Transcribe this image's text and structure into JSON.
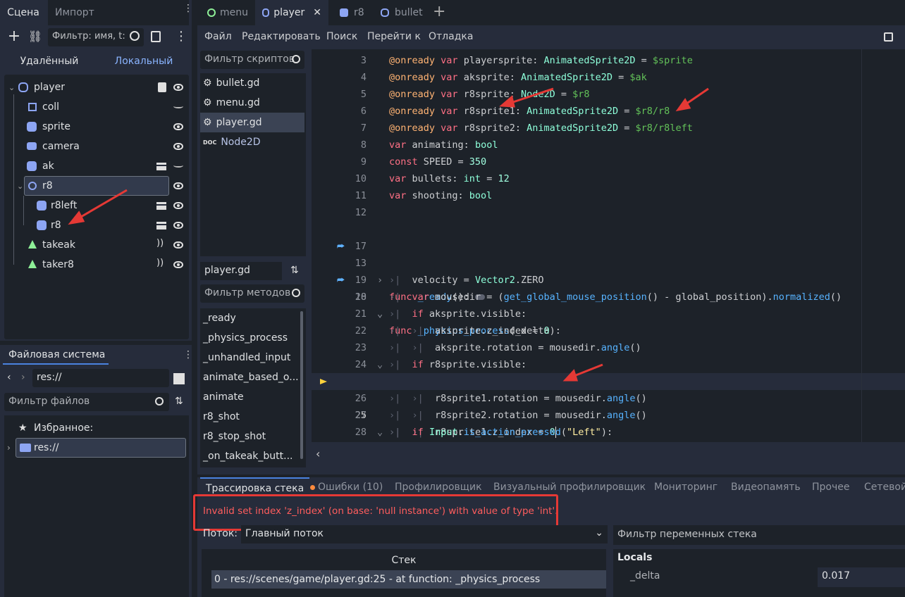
{
  "scene_dock": {
    "tabs": [
      "Сцена",
      "Импорт"
    ],
    "filter_placeholder": "Фильтр: имя, t:",
    "mode_remote": "Удалённый",
    "mode_local": "Локальный",
    "nodes": [
      {
        "label": "player",
        "icon": "character-icon"
      },
      {
        "label": "coll",
        "icon": "collision-shape-icon"
      },
      {
        "label": "sprite",
        "icon": "animated-sprite-icon"
      },
      {
        "label": "camera",
        "icon": "camera-icon"
      },
      {
        "label": "ak",
        "icon": "animated-sprite-icon"
      },
      {
        "label": "r8",
        "icon": "node2d-icon"
      },
      {
        "label": "r8left",
        "icon": "animated-sprite-icon"
      },
      {
        "label": "r8",
        "icon": "animated-sprite-icon"
      },
      {
        "label": "takeak",
        "icon": "area2d-icon"
      },
      {
        "label": "taker8",
        "icon": "area2d-icon"
      }
    ]
  },
  "filesystem_dock": {
    "title": "Файловая система",
    "path": "res://",
    "filter_placeholder": "Фильтр файлов",
    "favorites": "Избранное:",
    "root": "res://"
  },
  "editor_tabs": [
    {
      "label": "menu",
      "icon": "circle-icon"
    },
    {
      "label": "player",
      "icon": "character-icon"
    },
    {
      "label": "r8",
      "icon": "sprite-icon"
    },
    {
      "label": "bullet",
      "icon": "character-icon"
    }
  ],
  "menu": [
    "Файл",
    "Редактировать",
    "Поиск",
    "Перейти к",
    "Отладка"
  ],
  "scripts": {
    "filter_placeholder": "Фильтр скриптов",
    "items": [
      "bullet.gd",
      "menu.gd",
      "player.gd",
      "Node2D"
    ],
    "current": "player.gd",
    "methods_filter_placeholder": "Фильтр методов",
    "methods": [
      "_ready",
      "_physics_process",
      "_unhandled_input",
      "animate_based_o...",
      "animate",
      "r8_shot",
      "r8_stop_shot",
      "_on_takeak_butt..."
    ]
  },
  "code": {
    "line_numbers": [
      "3",
      "4",
      "5",
      "6",
      "7",
      "8",
      "9",
      "10",
      "11",
      "12",
      "13",
      "17",
      "18",
      "19",
      "20",
      "21",
      "22",
      "23",
      "24",
      "25",
      "26",
      "27",
      "28"
    ],
    "lines_text": [
      "@onready var playersprite: AnimatedSprite2D = $sprite",
      "@onready var aksprite: AnimatedSprite2D = $ak",
      "@onready var r8sprite: Node2D = $r8",
      "@onready var r8sprite1: AnimatedSprite2D = $r8/r8",
      "@onready var r8sprite2: AnimatedSprite2D = $r8/r8left",
      "var animating: bool",
      "const SPEED = 350",
      "var bullets: int = 12",
      "var shooting: bool",
      "",
      "func _ready():",
      "",
      "func _physics_process(_delta):",
      "velocity = Vector2.ZERO",
      "var mousedir = (get_global_mouse_position() - global_position).normalized()",
      "if aksprite.visible:",
      "aksprite.z_index = 0",
      "aksprite.rotation = mousedir.angle()",
      "if r8sprite.visible:",
      "r8sprite1.z_index = 0",
      "r8sprite1.rotation = mousedir.angle()",
      "r8sprite2.rotation = mousedir.angle()",
      "if Input.is_action_pressed(\"Left\"):"
    ]
  },
  "bottom_tabs": [
    "Трассировка стека",
    "Ошибки (10)",
    "Профилировщик",
    "Визуальный профилировщик",
    "Мониторинг",
    "Видеопамять",
    "Прочее",
    "Сетевой"
  ],
  "error_message": "Invalid set index 'z_index' (on base: 'null instance') with value of type 'int'.",
  "thread_label": "Поток:",
  "thread_value": "Главный поток",
  "stack_header": "Стек",
  "stack_frame": "0 - res://scenes/game/player.gd:25 - at function: _physics_process",
  "vars_filter_placeholder": "Фильтр переменных стека",
  "locals_header": "Locals",
  "locals": [
    {
      "name": "_delta",
      "value": "0.017"
    }
  ],
  "colors": {
    "accent": "#4a82e0",
    "error": "#ff5d5d",
    "annotation": "#e53935"
  }
}
